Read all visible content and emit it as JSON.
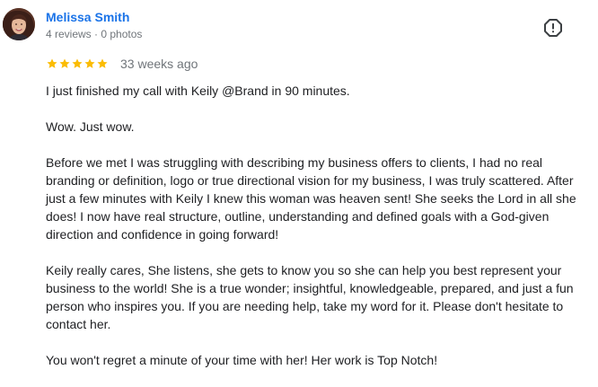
{
  "reviewer": {
    "name": "Melissa Smith",
    "meta": "4 reviews · 0 photos"
  },
  "rating": {
    "stars": 5,
    "max": 5,
    "date": "33 weeks ago",
    "star_color": "#fbbc04"
  },
  "review": {
    "paragraphs": [
      "I just finished my call with Keily @Brand in 90 minutes.",
      "Wow. Just wow.",
      "Before we met I was struggling with describing my business offers to clients, I had no real branding or definition, logo or true directional vision for my business, I was truly scattered. After just a few minutes with Keily I knew this woman was heaven sent! She seeks the Lord in all she does! I now have real structure, outline, understanding and defined goals with a God-given direction and confidence in going forward!",
      "Keily really cares, She listens, she gets to know you so she can help you best represent your business to the world! She is a true wonder; insightful, knowledgeable, prepared, and just a fun person who inspires you. If you are needing help, take my word for it. Please don't hesitate to contact her.",
      "You won't regret a minute of your time with her! Her work is Top Notch!"
    ]
  },
  "icons": {
    "avatar": "profile-photo",
    "flag": "report-flag-icon",
    "star": "star-icon"
  },
  "colors": {
    "name": "#1a73e8",
    "meta": "#70757a",
    "text": "#202124"
  }
}
